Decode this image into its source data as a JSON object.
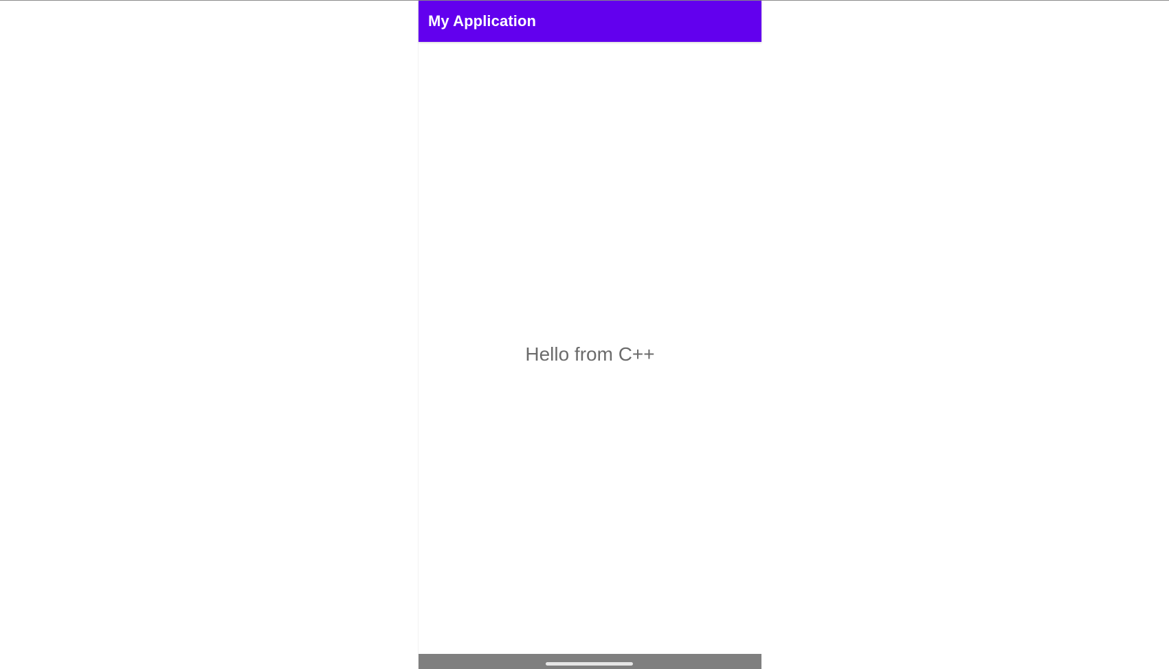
{
  "app": {
    "title": "My Application",
    "accent_color": "#6200EE"
  },
  "main": {
    "greeting": "Hello from C++",
    "text_color": "#6b6b6b"
  },
  "system": {
    "nav_handle": "home-gesture-handle",
    "nav_bar_color": "#7f7f7f"
  }
}
